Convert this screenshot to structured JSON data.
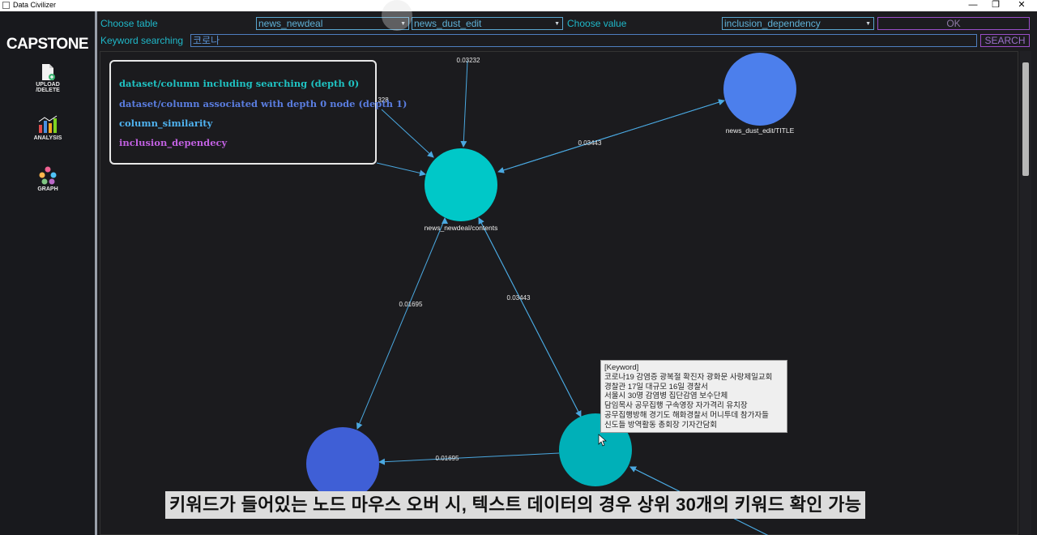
{
  "window": {
    "title": "Data Civilizer",
    "minimize": "—",
    "restore": "❐",
    "close": "✕"
  },
  "sidebar": {
    "brand": "CAPSTONE",
    "items": [
      {
        "icon": "upload-file-icon",
        "label": "UPLOAD\n/DELETE"
      },
      {
        "icon": "bar-chart-icon",
        "label": "ANALYSIS"
      },
      {
        "icon": "graph-network-icon",
        "label": "GRAPH"
      }
    ]
  },
  "toolbar": {
    "choose_table_label": "Choose table",
    "table1_value": "news_newdeal",
    "table2_value": "news_dust_edit",
    "choose_value_label": "Choose value",
    "value_select": "inclusion_dependency",
    "ok_label": "OK",
    "keyword_label": "Keyword searching",
    "keyword_value": "코로나",
    "search_label": "SEARCH"
  },
  "legend": {
    "items": [
      {
        "label": "dataset/column including searching (depth 0)",
        "color": "#1fc2c2"
      },
      {
        "label": "dataset/column associated with depth 0 node (depth 1)",
        "color": "#5a7de0"
      },
      {
        "label": "column_similarity",
        "color": "#4fb3f0"
      },
      {
        "label": "inclusion_dependecy",
        "color": "#c060e0"
      }
    ]
  },
  "graph": {
    "nodes": [
      {
        "id": "news_newdeal/contents",
        "label": "news_newdeal/contents",
        "color": "#00c8c8"
      },
      {
        "id": "news_dust_edit/TITLE",
        "label": "news_dust_edit/TITLE",
        "color": "#4c7fec"
      },
      {
        "id": "bottom-left",
        "label": "",
        "color": "#3f5fd6"
      },
      {
        "id": "bottom-right",
        "label": "",
        "color": "#00b0b8"
      }
    ],
    "edges": [
      {
        "label": "0.03232",
        "color": "#4aa8e0"
      },
      {
        "label": "0.03443",
        "color": "#4aa8e0"
      },
      {
        "label": "0.01695",
        "color": "#4aa8e0"
      },
      {
        "label": "0.03443",
        "color": "#4aa8e0"
      },
      {
        "label": "0.01695",
        "color": "#4aa8e0"
      }
    ],
    "partial_edge_label": "328"
  },
  "tooltip": {
    "lines": [
      "[Keyword]",
      "코로나19 감염증 광복절 확진자 광화문 사랑제일교회",
      "경찰관 17일 대규모 16일 경찰서",
      "서울시 30명 감염병 집단감염 보수단체",
      "담임목사 공무집행 구속영장 자가격리 유치장",
      "공무집행방해 경기도 해화경찰서 머니투데 참가자들",
      "신도들 방역활동 총회장 기자간담회"
    ]
  },
  "caption": "키워드가 들어있는 노드 마우스 오버 시, 텍스트 데이터의 경우 상위 30개의 키워드 확인 가능"
}
